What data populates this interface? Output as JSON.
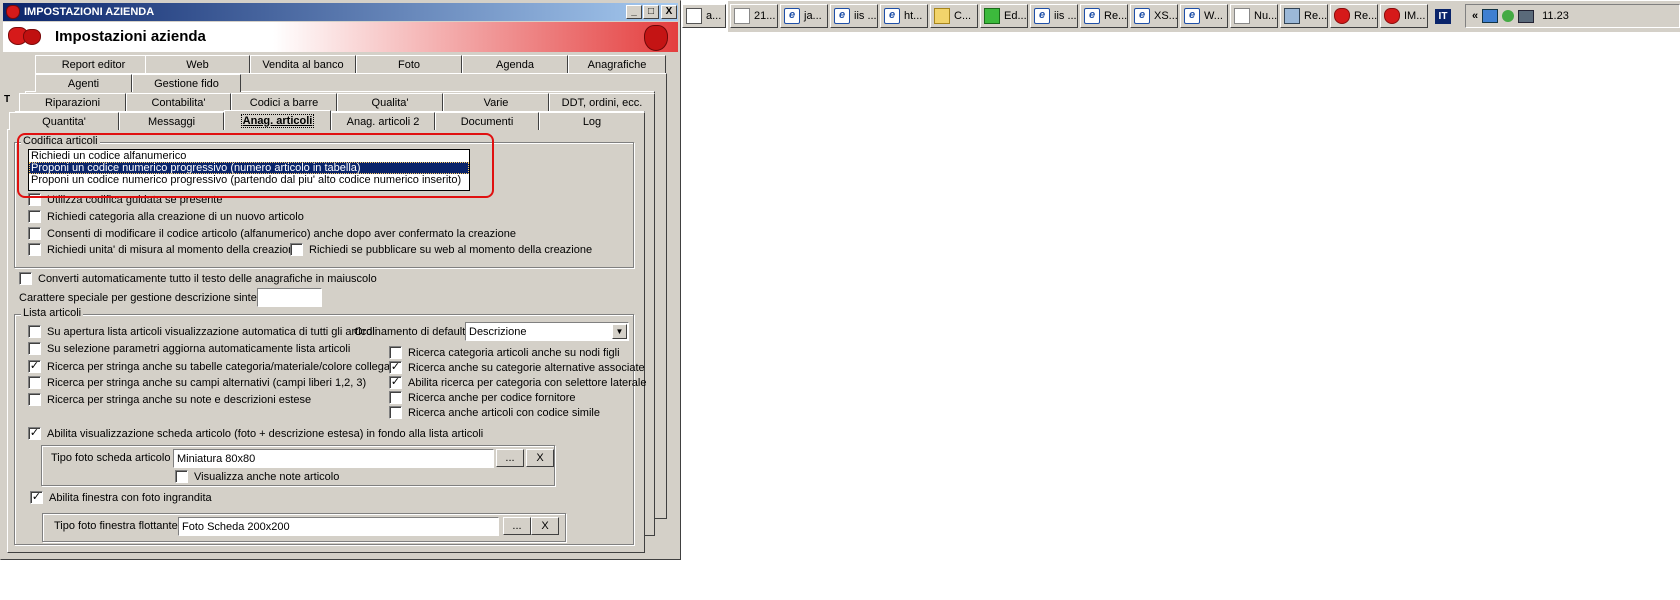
{
  "window": {
    "title": "IMPOSTAZIONI AZIENDA",
    "header_title": "Impostazioni azienda",
    "buttons": {
      "minimize": "_",
      "maximize": "□",
      "close": "X"
    }
  },
  "tabs": {
    "row1": [
      "Report editor",
      "Web",
      "Vendita al banco",
      "Foto",
      "Agenda",
      "Anagrafiche"
    ],
    "row2": [
      "Agenti",
      "Gestione fido"
    ],
    "row3": [
      "Riparazioni",
      "Contabilita'",
      "Codici a barre",
      "Qualita'",
      "Varie",
      "DDT, ordini, ecc."
    ],
    "row4": [
      "Quantita'",
      "Messaggi",
      "Anag. articoli",
      "Anag. articoli 2",
      "Documenti",
      "Log"
    ],
    "active": "Anag. articoli",
    "stray_letter": "T"
  },
  "codifica": {
    "group_label": "Codifica articoli",
    "options": [
      "Richiedi un codice alfanumerico",
      "Proponi un codice numerico progressivo (numero articolo in tabella)",
      "Proponi un codice numerico progressivo (partendo dal piu' alto codice numerico inserito)"
    ],
    "selected_index": 1,
    "checkboxes": [
      {
        "label": "Utilizza codifica guidata se presente",
        "checked": false
      },
      {
        "label": "Richiedi categoria alla creazione di un nuovo articolo",
        "checked": false
      },
      {
        "label": "Consenti di modificare il codice articolo (alfanumerico) anche dopo aver confermato la creazione",
        "checked": false
      },
      {
        "label": "Richiedi unita' di misura al momento della creazione",
        "checked": false
      },
      {
        "label": "Richiedi se pubblicare su web al momento della creazione",
        "checked": false
      }
    ]
  },
  "general": {
    "uppercase": {
      "label": "Converti automaticamente tutto il testo delle anagrafiche in maiuscolo",
      "checked": false
    },
    "special_char_label": "Carattere speciale per gestione descrizione sintetica :",
    "special_char_value": ""
  },
  "lista": {
    "group_label": "Lista articoli",
    "left": [
      {
        "label": "Su apertura lista articoli visualizzazione automatica di tutti gli articoli",
        "checked": false
      },
      {
        "label": "Su selezione parametri aggiorna automaticamente lista articoli",
        "checked": false
      },
      {
        "label": "Ricerca per stringa anche su tabelle categoria/materiale/colore collegate",
        "checked": true
      },
      {
        "label": "Ricerca per stringa anche su campi alternativi (campi liberi 1,2, 3)",
        "checked": false
      },
      {
        "label": "Ricerca per stringa anche su note e descrizioni estese",
        "checked": false
      }
    ],
    "order_label": "Ordinamento di default :",
    "order_value": "Descrizione",
    "right": [
      {
        "label": "Ricerca categoria articoli anche su nodi figli",
        "checked": false
      },
      {
        "label": "Ricerca anche su categorie alternative associate",
        "checked": true
      },
      {
        "label": "Abilita ricerca per categoria con selettore laterale",
        "checked": true
      },
      {
        "label": "Ricerca anche per codice fornitore",
        "checked": false
      },
      {
        "label": "Ricerca anche articoli con codice simile",
        "checked": false
      }
    ],
    "scheda": {
      "label": "Abilita visualizzazione scheda articolo (foto + descrizione estesa) in fondo alla lista articoli",
      "checked": true
    },
    "tipo_foto_label": "Tipo foto scheda articolo :",
    "tipo_foto_value": "Miniatura 80x80",
    "note": {
      "label": "Visualizza anche note articolo",
      "checked": false
    },
    "finestra": {
      "label": "Abilita finestra con foto ingrandita",
      "checked": true
    },
    "tipo_floating_label": "Tipo foto finestra flottante :",
    "tipo_floating_value": "Foto Scheda 200x200",
    "browse_label": "...",
    "clear_label": "X"
  },
  "taskbar": {
    "items": [
      {
        "label": "a...",
        "icon": "doc-icon"
      },
      {
        "label": "21...",
        "icon": "mail-icon"
      },
      {
        "label": "ja...",
        "icon": "ie-icon"
      },
      {
        "label": "iis ...",
        "icon": "ie-icon"
      },
      {
        "label": "ht...",
        "icon": "ie-icon"
      },
      {
        "label": "C...",
        "icon": "folder-icon"
      },
      {
        "label": "Ed...",
        "icon": "editor-icon"
      },
      {
        "label": "iis ...",
        "icon": "ie-icon"
      },
      {
        "label": "Re...",
        "icon": "ie-icon"
      },
      {
        "label": "XS...",
        "icon": "ie-icon"
      },
      {
        "label": "W...",
        "icon": "ie-icon"
      },
      {
        "label": "Nu...",
        "icon": "mail-icon"
      },
      {
        "label": "Re...",
        "icon": "network-icon"
      },
      {
        "label": "Re...",
        "icon": "strawberry-icon"
      },
      {
        "label": "IM...",
        "icon": "strawberry-icon"
      }
    ],
    "lang": "IT",
    "chevron": "«",
    "clock": "11.23"
  }
}
